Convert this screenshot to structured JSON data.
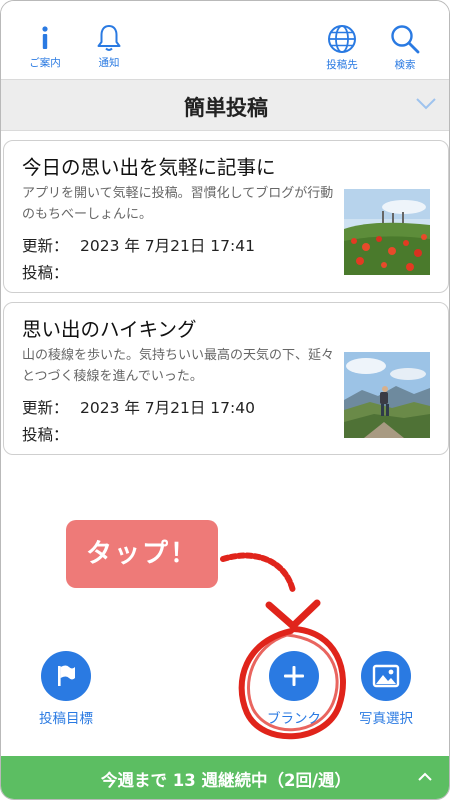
{
  "toolbar": {
    "info_label": "ご案内",
    "notify_label": "通知",
    "post_dest_label": "投稿先",
    "search_label": "検索"
  },
  "titlebar": {
    "title": "簡単投稿"
  },
  "meta_labels": {
    "updated": "更新：",
    "posted": "投稿："
  },
  "posts": [
    {
      "title": "今日の思い出を気軽に記事に",
      "description": "アプリを開いて気軽に投稿。習慣化してブログが行動のもちべーしょんに。",
      "updated": "2023 年 7月21日 17:41",
      "posted": ""
    },
    {
      "title": "思い出のハイキング",
      "description": "山の稜線を歩いた。気持ちいい最高の天気の下、延々とつづく稜線を進んでいった。",
      "updated": "2023 年 7月21日 17:40",
      "posted": ""
    }
  ],
  "callout": {
    "text": "タップ！"
  },
  "actions": {
    "goal_label": "投稿目標",
    "blank_label": "ブランク",
    "photo_label": "写真選択"
  },
  "footer": {
    "streak_text": "今週まで 13 週継続中（2回/週）"
  },
  "colors": {
    "accent": "#2a7ae2",
    "footer": "#5cbe62",
    "callout": "#ee7a78",
    "annotation": "#e0241b"
  }
}
